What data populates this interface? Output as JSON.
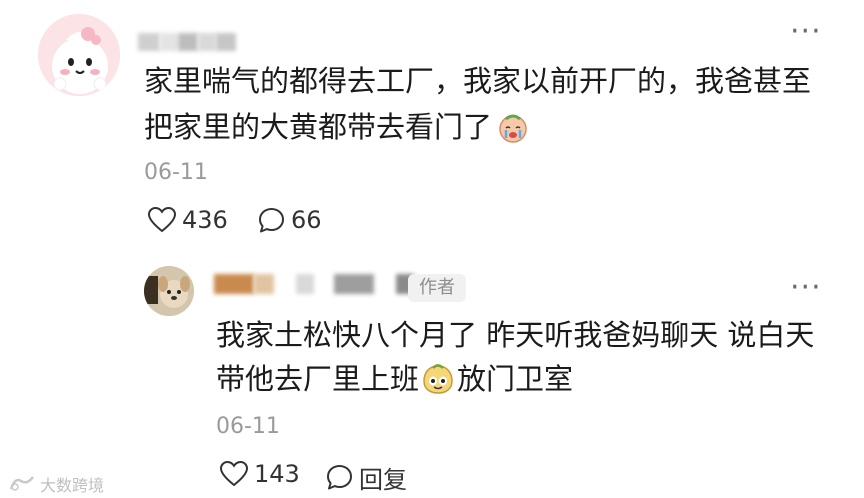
{
  "comment": {
    "text_line1": "家里喘气的都得去工厂，我家以前开厂的，我爸甚至",
    "text_line2": "把家里的大黄都带去看门了",
    "date": "06-11",
    "like_count": "436",
    "reply_count": "66",
    "more_label": "···"
  },
  "reply": {
    "author_badge": "作者",
    "text_line1": "我家土松快八个月了 昨天听我爸妈聊天 说白天",
    "text_line2a": "带他去厂里上班",
    "text_line2b": "放门卫室",
    "date": "06-11",
    "like_count": "143",
    "reply_label": "回复",
    "more_label": "···"
  },
  "watermark": {
    "text": "大数跨境"
  },
  "icons": {
    "like": "heart-outline-icon",
    "comment": "speech-bubble-icon",
    "more": "ellipsis-icon"
  },
  "colors": {
    "text": "#1b1b1b",
    "muted": "#9a9a9a",
    "badge_bg": "#f1f1f1"
  }
}
